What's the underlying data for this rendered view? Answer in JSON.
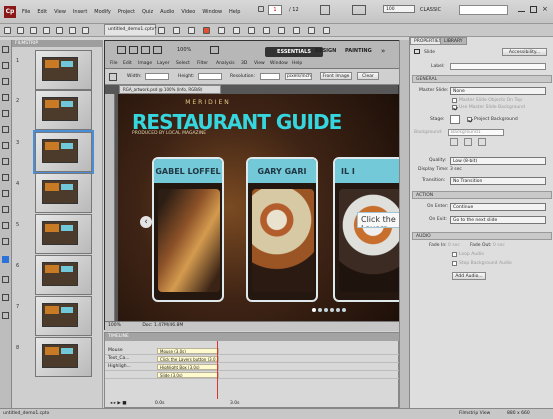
{
  "app": {
    "logo": "Cp",
    "menu": [
      "File",
      "Edit",
      "View",
      "Insert",
      "Modify",
      "Project",
      "Quiz",
      "Audio",
      "Video",
      "Window",
      "Help"
    ],
    "slide_current": "1",
    "slide_total": "/ 12",
    "zoom": "100",
    "workspace": "CLASSIC",
    "doc_tab": "untitled_demo1.cptx*"
  },
  "filmstrip": {
    "title": "FILMSTRIP",
    "slides": [
      "1",
      "2",
      "3",
      "4",
      "5",
      "6",
      "7",
      "8"
    ]
  },
  "photoshop": {
    "zoom": "100%",
    "ribbon": [
      "ESSENTIALS",
      "DESIGN",
      "PAINTING"
    ],
    "menu": [
      "File",
      "Edit",
      "Image",
      "Layer",
      "Select",
      "Filter",
      "Analysis",
      "3D",
      "View",
      "Window",
      "Help"
    ],
    "opt_width": "Width:",
    "opt_height": "Height:",
    "opt_resolution": "Resolution:",
    "opt_units": "pixels/inch",
    "front_image": "Front Image",
    "clear": "Clear",
    "tab": "RGA_artwork.psd @ 100% (Info, RGB/8)",
    "status_zoom": "100%",
    "status_doc": "Doc: 1.47M/46.8M",
    "meridien": "MERIDIEN",
    "title": "RESTAURANT GUIDE",
    "produced": "PRODUCED BY LOCAL MAGAZINE",
    "cards": [
      "GABEL LOFFEL",
      "GARY GARI",
      "IL I"
    ],
    "callout": "Click the Layers",
    "dots_count": 6,
    "active_dot": 0
  },
  "timeline": {
    "title": "TIMELINE",
    "rows": [
      {
        "name": "Mouse",
        "bar": "Mouse (3.0s)"
      },
      {
        "name": "Text_Ca...",
        "bar": "Click the Layers button (3.0..."
      },
      {
        "name": "Highligh...",
        "bar": "Highlight Box (3.0s)"
      },
      {
        "name": "",
        "bar": "Slide (3.0s)"
      }
    ],
    "playhead": "0.0s",
    "duration": "3.0s"
  },
  "properties": {
    "tabs": [
      "PROPERTIES",
      "LIBRARY"
    ],
    "slide_label": "Slide",
    "accessibility": "Accessibility...",
    "label_field": "Label:",
    "general": "GENERAL",
    "master_slide": "Master Slide:",
    "master_slide_value": "None",
    "opt_master_top": "Master Slide Objects On Top",
    "opt_master_bg": "Use Master Slide Background",
    "stage": "Stage:",
    "project_background": "Project Background",
    "background": "Background:",
    "background_value": "Background1",
    "quality": "Quality:",
    "quality_value": "Low (8-bit)",
    "display_time": "Display Time:",
    "display_time_value": "3 sec",
    "transition": "Transition:",
    "transition_value": "No Transition",
    "action": "ACTION",
    "on_enter": "On Enter:",
    "on_enter_value": "Continue",
    "on_exit": "On Exit:",
    "on_exit_value": "Go to the next slide",
    "audio": "AUDIO",
    "fade_in": "Fade In:",
    "fade_in_value": "0 sec",
    "fade_out": "Fade Out:",
    "fade_out_value": "0 sec",
    "loop_audio": "Loop Audio",
    "stop_bg_audio": "Stop Background Audio",
    "add_audio": "Add Audio..."
  },
  "statusbar": {
    "file": "untitled_demo1.cptx",
    "view": "Filmstrip View",
    "size": "880 x 660"
  },
  "colors": {
    "accent": "#36d6df",
    "brand": "#8b1818",
    "card_header": "#74c9d8"
  }
}
